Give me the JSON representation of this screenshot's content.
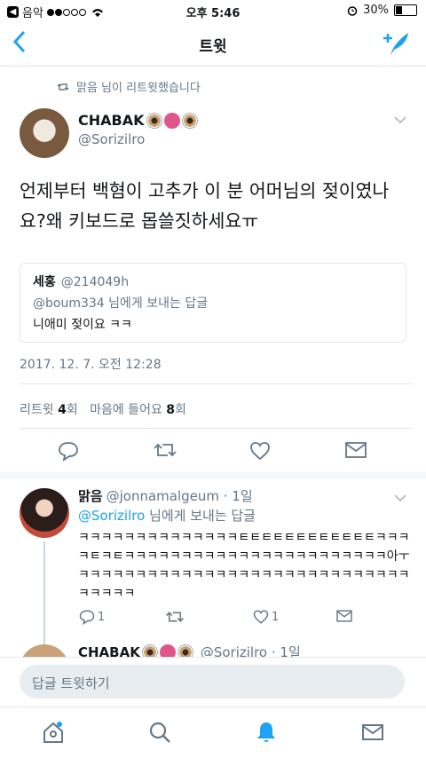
{
  "status_bar": {
    "carrier": "음악",
    "time": "오후 5:46",
    "battery": "30%"
  },
  "nav": {
    "title": "트윗"
  },
  "retweet_note": "맑음 님이 리트윗했습니다",
  "tweet": {
    "name": "CHABAK",
    "handle": "@Sorizilro",
    "text": "언제부터 백혐이 고추가 이 분 어머님의 젖이였나요?왜 키보드로 몹쓸짓하세요ㅠ",
    "quote": {
      "name": "세홍",
      "handle": "@214049h",
      "reply_to": "@boum334 님에게 보내는 답글",
      "text": "니애미 젖이요 ㅋㅋ"
    },
    "timestamp": "2017. 12. 7. 오전 12:28",
    "retweet_label": "리트윗",
    "retweet_count": "4",
    "count_unit_1": "회",
    "like_label": "마음에 들어요",
    "like_count": "8",
    "count_unit_2": "회"
  },
  "reply": {
    "name": "맑음",
    "handle": "@jonnamalgeum · 1일",
    "mention": "@Sorizilro",
    "to_suffix": " 님에게 보내는 답글",
    "text": "ㅋㅋㅋㅋㅋㅋㅋㅋㅋㅋㅋㅋㅋㅋㅌㅌㅌㅌㅌㅌㅌㅌㅌㅌㅌㅌㅋㅋㅋㅋㅌㅋㅌㅋㅋㅋㅋㅋㅋㅋㅋㅋㅋㅋㅋㅋㅋㅋㅋㅋㅋㅋㅋㅋㅋㅋ아ㅜㅋㅋㅋㅋㅋㅋㅋㅋㅋㅋㅋㅋㅋㅋㅋㅋㅋㅋㅋㅋㅋㅋㅋㅋㅋㅋㅋㅋㅋㅋㅋㅋㅋㅋ",
    "reply_count": "1",
    "like_count": "1"
  },
  "next_tweet": {
    "name": "CHABAK",
    "handle": "@Sorizilro · 1일"
  },
  "compose_placeholder": "답글 트윗하기",
  "colors": {
    "accent": "#1da1f2",
    "muted": "#657786",
    "divider": "#e1e8ed"
  }
}
